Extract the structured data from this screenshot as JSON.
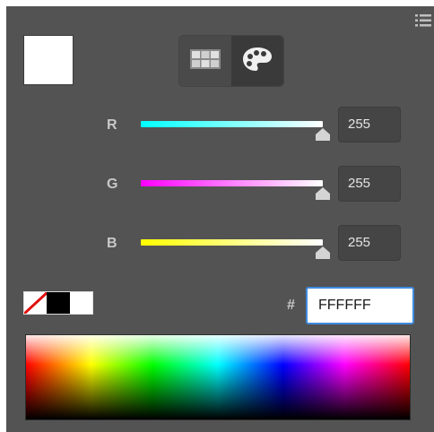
{
  "panel": {
    "menu_icon": "panel-menu-icon",
    "preview_color": "#FFFFFF"
  },
  "mode_toggle": {
    "options": [
      {
        "icon": "swatch-grid-icon",
        "selected": false
      },
      {
        "icon": "palette-icon",
        "selected": true
      }
    ]
  },
  "channels": [
    {
      "label": "R",
      "value": "255",
      "level": 1.0,
      "track_from": "#00ffff",
      "track_to": "#ffffff"
    },
    {
      "label": "G",
      "value": "255",
      "level": 1.0,
      "track_from": "#ff00ff",
      "track_to": "#ffffff"
    },
    {
      "label": "B",
      "value": "255",
      "level": 1.0,
      "track_from": "#ffff00",
      "track_to": "#ffffff"
    }
  ],
  "swatches": {
    "items": [
      {
        "name": "none-swatch",
        "color": "#ffffff"
      },
      {
        "name": "black-swatch",
        "color": "#000000"
      },
      {
        "name": "white-swatch",
        "color": "#ffffff"
      }
    ]
  },
  "hex": {
    "symbol": "#",
    "value": "FFFFFF"
  },
  "colors": {
    "panel_bg": "#535353",
    "accent_focus": "#3f8ae0"
  }
}
